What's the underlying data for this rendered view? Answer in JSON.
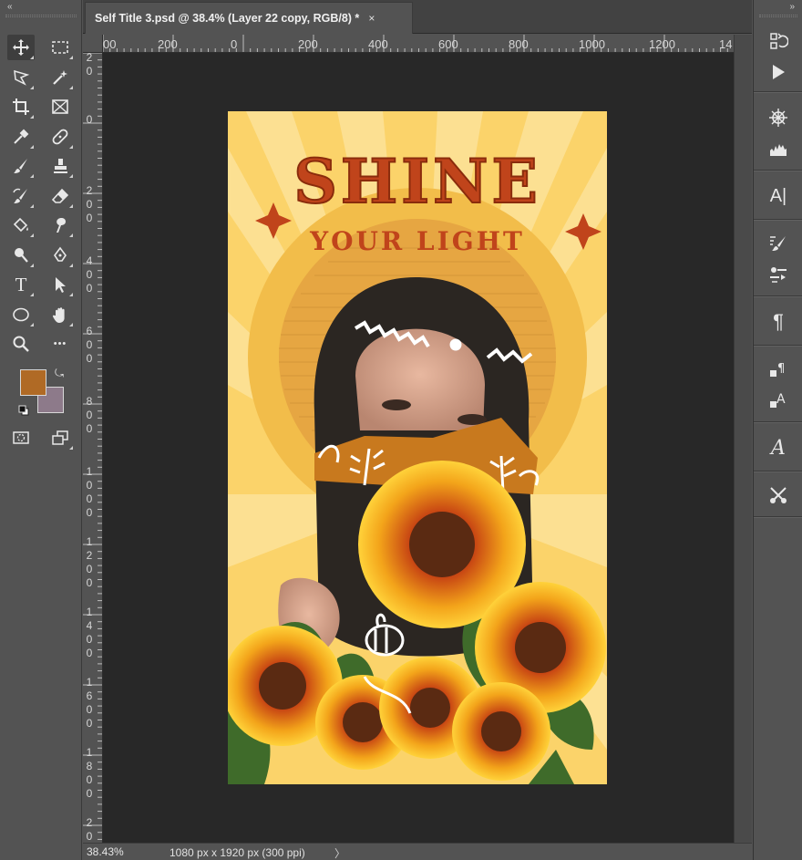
{
  "toolbar": {
    "collapse_label": "«",
    "tools": [
      {
        "name": "move-tool",
        "icon": "move-icon"
      },
      {
        "name": "marquee-tool",
        "icon": "rect-marquee-icon"
      },
      {
        "name": "lasso-tool",
        "icon": "polygonal-lasso-icon"
      },
      {
        "name": "magic-wand-tool",
        "icon": "magic-wand-icon"
      },
      {
        "name": "crop-tool",
        "icon": "crop-icon"
      },
      {
        "name": "frame-tool",
        "icon": "frame-icon"
      },
      {
        "name": "eyedropper-tool",
        "icon": "eyedropper-icon"
      },
      {
        "name": "healing-brush-tool",
        "icon": "bandage-icon"
      },
      {
        "name": "brush-tool",
        "icon": "brush-icon"
      },
      {
        "name": "clone-stamp-tool",
        "icon": "stamp-icon"
      },
      {
        "name": "history-brush-tool",
        "icon": "history-brush-icon"
      },
      {
        "name": "eraser-tool",
        "icon": "eraser-icon"
      },
      {
        "name": "paint-bucket-tool",
        "icon": "bucket-icon"
      },
      {
        "name": "smudge-tool",
        "icon": "smudge-icon"
      },
      {
        "name": "dodge-tool",
        "icon": "dodge-icon"
      },
      {
        "name": "pen-tool",
        "icon": "pen-icon"
      },
      {
        "name": "type-tool",
        "icon": "type-icon"
      },
      {
        "name": "path-selection-tool",
        "icon": "arrow-icon"
      },
      {
        "name": "ellipse-tool",
        "icon": "ellipse-icon"
      },
      {
        "name": "hand-tool",
        "icon": "hand-icon"
      },
      {
        "name": "zoom-tool",
        "icon": "zoom-icon"
      },
      {
        "name": "more-tools",
        "icon": "ellipsis-icon"
      }
    ],
    "type_glyph": "T",
    "more_glyph": "•••",
    "swap_glyph": "⤿",
    "foreground_color": "#b06a25",
    "background_color": "#8d7a8a"
  },
  "document": {
    "tab_title": "Self Title 3.psd @ 38.4% (Layer 22 copy, RGB/8) *",
    "close_glyph": "×"
  },
  "rulers": {
    "horizontal": [
      "00",
      "200",
      "0",
      "200",
      "400",
      "600",
      "800",
      "1000",
      "1200",
      "14"
    ],
    "vertical": [
      "2 0",
      "0",
      "2 0 0",
      "4 0 0",
      "6 0 0",
      "8 0 0",
      "1 0 0 0",
      "1 2 0 0",
      "1 4 0 0",
      "1 6 0 0",
      "1 8 0 0",
      "2 0"
    ]
  },
  "artwork": {
    "headline": "SHINE",
    "subheadline": "YOUR LIGHT",
    "background_color": "#fbd36a",
    "headline_color": "#c0441b"
  },
  "status": {
    "zoom": "38.43%",
    "doc_info": "1080 px x 1920 px (300 ppi)",
    "arrow": "〉"
  },
  "panels": {
    "collapse_label": "»",
    "paragraph_glyph": "¶",
    "char_glyph": "A|",
    "glyph_a": "A",
    "buttons": [
      "history-icon",
      "play-icon",
      "navigator-icon",
      "histogram-icon",
      "character-icon",
      "brush-settings-icon",
      "tool-presets-icon",
      "paragraph-icon",
      "paragraph-styles-icon",
      "character-styles-icon",
      "glyphs-icon",
      "properties-icon"
    ]
  }
}
